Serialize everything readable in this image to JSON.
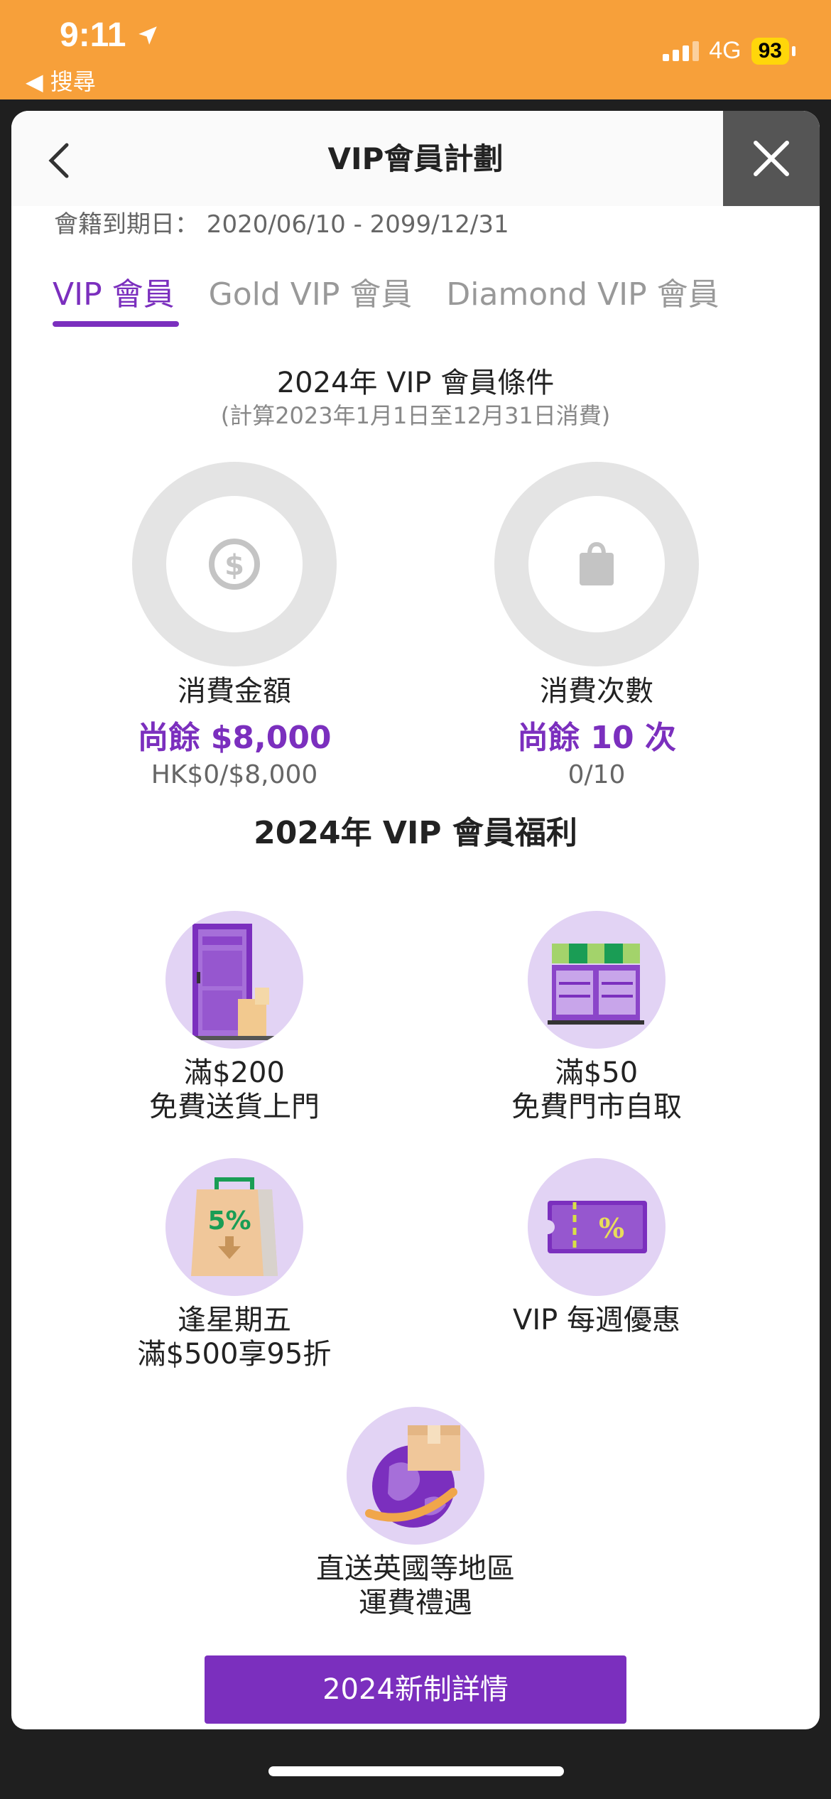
{
  "status_bar": {
    "time": "9:11",
    "back_app": "◀ 搜尋",
    "network": "4G",
    "battery": "93"
  },
  "header": {
    "title": "VIP會員計劃"
  },
  "membership": {
    "expiry": "會籍到期日： 2020/06/10 - 2099/12/31"
  },
  "tabs": [
    {
      "label": "VIP 會員",
      "active": true
    },
    {
      "label": "Gold VIP 會員",
      "active": false
    },
    {
      "label": "Diamond VIP 會員",
      "active": false
    }
  ],
  "conditions": {
    "title": "2024年 VIP 會員條件",
    "subtitle": "(計算2023年1月1日至12月31日消費)",
    "items": [
      {
        "icon": "dollar-coin-icon",
        "name": "消費金額",
        "remaining": "尚餘 $8,000",
        "progress": "HK$0/$8,000",
        "progress_fraction": 0
      },
      {
        "icon": "shopping-bag-icon",
        "name": "消費次數",
        "remaining": "尚餘 10 次",
        "progress": "0/10",
        "progress_fraction": 0
      }
    ]
  },
  "benefits": {
    "title": "2024年 VIP 會員福利",
    "items": [
      {
        "icon": "door-delivery-icon",
        "line1": "滿$200",
        "line2": "免費送貨上門"
      },
      {
        "icon": "store-pickup-icon",
        "line1": "滿$50",
        "line2": "免費門市自取"
      },
      {
        "icon": "discount-bag-icon",
        "line1": "逢星期五",
        "line2": "滿$500享95折",
        "badge": "5%"
      },
      {
        "icon": "coupon-icon",
        "line1": "VIP 每週優惠",
        "line2": "",
        "badge": "%"
      },
      {
        "icon": "global-shipping-icon",
        "line1": "直送英國等地區",
        "line2": "運費禮遇"
      }
    ]
  },
  "details_button": {
    "label": "2024新制詳情"
  },
  "colors": {
    "accent": "#7b2fbe",
    "status_bar": "#f7a03a",
    "icon_bg": "#e2d3f4"
  }
}
